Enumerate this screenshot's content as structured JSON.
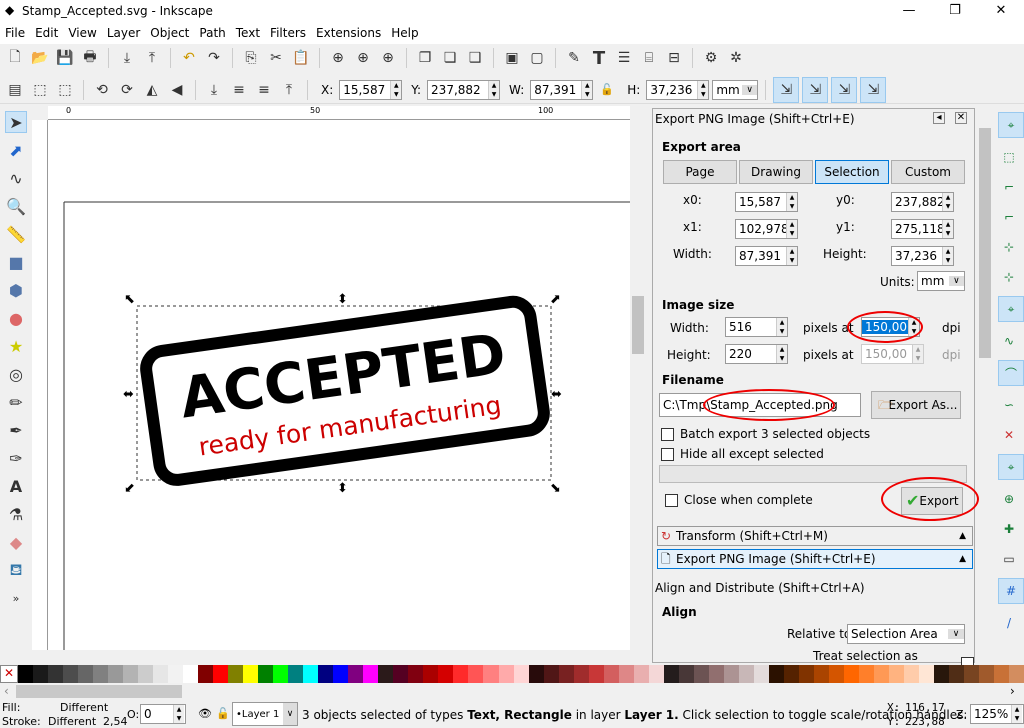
{
  "window": {
    "title": "Stamp_Accepted.svg - Inkscape",
    "minimize": "—",
    "maximize": "❐",
    "close": "✕"
  },
  "menu": [
    "File",
    "Edit",
    "View",
    "Layer",
    "Object",
    "Path",
    "Text",
    "Filters",
    "Extensions",
    "Help"
  ],
  "toolbar": {
    "x_label": "X:",
    "x": "15,587",
    "y_label": "Y:",
    "y": "237,882",
    "w_label": "W:",
    "w": "87,391",
    "h_label": "H:",
    "h": "37,236",
    "unit": "mm"
  },
  "canvas": {
    "stamp_title": "ACCEPTED",
    "stamp_subtitle": "ready for manufacturing",
    "ruler_labels": [
      "0",
      "50",
      "100"
    ]
  },
  "export_panel": {
    "title": "Export PNG Image (Shift+Ctrl+E)",
    "export_area_label": "Export area",
    "area_buttons": [
      "Page",
      "Drawing",
      "Selection",
      "Custom"
    ],
    "selected_area": "Selection",
    "x0_label": "x0:",
    "x0": "15,587",
    "y0_label": "y0:",
    "y0": "237,882",
    "x1_label": "x1:",
    "x1": "102,978",
    "y1_label": "y1:",
    "y1": "275,118",
    "width_label": "Width:",
    "width": "87,391",
    "height_label": "Height:",
    "height": "37,236",
    "units_label": "Units:",
    "units": "mm",
    "image_size_label": "Image size",
    "img_width_label": "Width:",
    "img_width": "516",
    "pixels_at": "pixels at",
    "dpi_x": "150,00",
    "dpi": "dpi",
    "img_height_label": "Height:",
    "img_height": "220",
    "dpi_y": "150,00",
    "filename_label": "Filename",
    "filename": "C:\\Tmp\\Stamp_Accepted.png",
    "export_as": "Export As...",
    "batch_export": "Batch export 3 selected objects",
    "hide_all": "Hide all except selected",
    "close_when_complete": "Close when complete",
    "export_button": "Export"
  },
  "docks": {
    "transform": "Transform (Shift+Ctrl+M)",
    "export": "Export PNG Image (Shift+Ctrl+E)",
    "align": "Align and Distribute (Shift+Ctrl+A)",
    "align_heading": "Align",
    "relative_to_label": "Relative to:",
    "relative_to": "Selection Area",
    "treat_as_group": "Treat selection as group:"
  },
  "palette": [
    "#000000",
    "#1a1a1a",
    "#333333",
    "#4d4d4d",
    "#666666",
    "#808080",
    "#999999",
    "#b3b3b3",
    "#cccccc",
    "#e6e6e6",
    "#f2f2f2",
    "#ffffff",
    "#800000",
    "#ff0000",
    "#808000",
    "#ffff00",
    "#008000",
    "#00ff00",
    "#008080",
    "#00ffff",
    "#000080",
    "#0000ff",
    "#800080",
    "#ff00ff",
    "#2b1a1a",
    "#550022",
    "#800010",
    "#aa0000",
    "#d40000",
    "#ff2a2a",
    "#ff5555",
    "#ff8080",
    "#ffaaaa",
    "#ffd5d5",
    "#280b0b",
    "#501616",
    "#782121",
    "#a02c2c",
    "#c83737",
    "#d35f5f",
    "#de8787",
    "#e9afaf",
    "#f4d7d7",
    "#241c1c",
    "#483737",
    "#6c5353",
    "#916f6f",
    "#ac9393",
    "#c8b7b7",
    "#e3dbdb",
    "#2b1100",
    "#552200",
    "#803300",
    "#aa4400",
    "#d45500",
    "#ff6600",
    "#ff7f2a",
    "#ff9955",
    "#ffb380",
    "#ffccaa",
    "#ffe6d5",
    "#28170b",
    "#502d16",
    "#784421",
    "#a05a2c",
    "#c87137",
    "#d38d5f"
  ],
  "status": {
    "fill_label": "Fill:",
    "fill": "Different",
    "stroke_label": "Stroke:",
    "stroke": "Different",
    "stroke_width": "2,54",
    "opacity_label": "O:",
    "opacity": "0",
    "layer": "•Layer 1",
    "message_pre": "3 objects selected of types ",
    "types": "Text, Rectangle",
    "message_mid": " in layer ",
    "layer_name": "Layer 1.",
    "message_post": " Click selection to toggle scale/rotation handles.",
    "x_label": "X:",
    "x": "116,17",
    "y_label": "Y:",
    "y": "223,88",
    "zoom_label": "Z:",
    "zoom": "125%"
  },
  "colors": {
    "accent": "#0078d7",
    "annotation": "#e00000",
    "stamp_red": "#cc0000"
  }
}
